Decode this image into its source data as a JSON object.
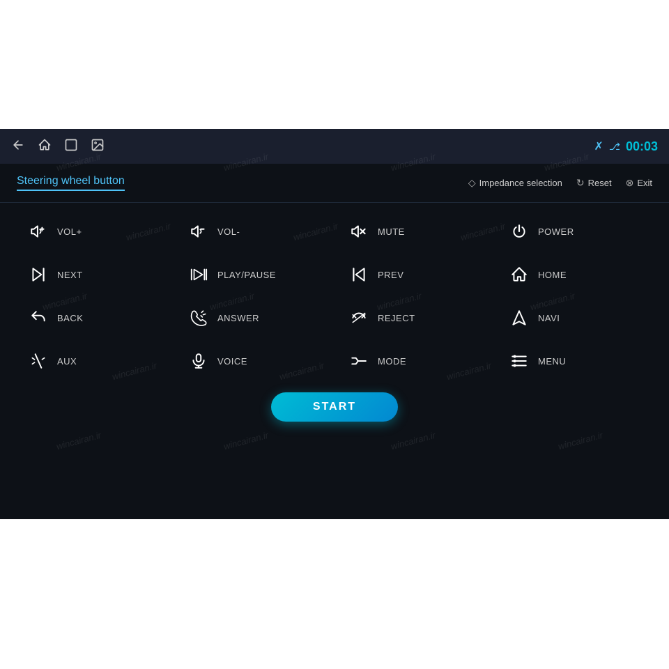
{
  "app": {
    "title": "Steering wheel button",
    "timer": "00:03"
  },
  "topbar": {
    "icons": [
      "back-arrow",
      "home-icon",
      "window-icon",
      "image-icon",
      "bluetooth-icon",
      "timer"
    ]
  },
  "header": {
    "title": "Steering wheel button",
    "actions": [
      {
        "icon": "shield-icon",
        "label": "Impedance selection"
      },
      {
        "icon": "reset-icon",
        "label": "Reset"
      },
      {
        "icon": "exit-icon",
        "label": "Exit"
      }
    ]
  },
  "grid": [
    {
      "id": "vol-plus",
      "icon": "vol-plus-icon",
      "label": "VOL+"
    },
    {
      "id": "vol-minus",
      "icon": "vol-minus-icon",
      "label": "VOL-"
    },
    {
      "id": "mute",
      "icon": "mute-icon",
      "label": "MUTE"
    },
    {
      "id": "power",
      "icon": "power-icon",
      "label": "POWER"
    },
    {
      "id": "next",
      "icon": "next-icon",
      "label": "NEXT"
    },
    {
      "id": "play-pause",
      "icon": "play-pause-icon",
      "label": "PLAY/PAUSE"
    },
    {
      "id": "prev",
      "icon": "prev-icon",
      "label": "PREV"
    },
    {
      "id": "home",
      "icon": "home-btn-icon",
      "label": "HOME"
    },
    {
      "id": "back",
      "icon": "back-icon",
      "label": "BACK"
    },
    {
      "id": "answer",
      "icon": "answer-icon",
      "label": "ANSWER"
    },
    {
      "id": "reject",
      "icon": "reject-icon",
      "label": "REJECT"
    },
    {
      "id": "navi",
      "icon": "navi-icon",
      "label": "NAVI"
    },
    {
      "id": "aux",
      "icon": "aux-icon",
      "label": "AUX"
    },
    {
      "id": "voice",
      "icon": "voice-icon",
      "label": "VOICE"
    },
    {
      "id": "mode",
      "icon": "mode-icon",
      "label": "MODE"
    },
    {
      "id": "menu",
      "icon": "menu-icon",
      "label": "MENU"
    }
  ],
  "start_button": "START",
  "watermarks": [
    "wincairan.ir"
  ]
}
